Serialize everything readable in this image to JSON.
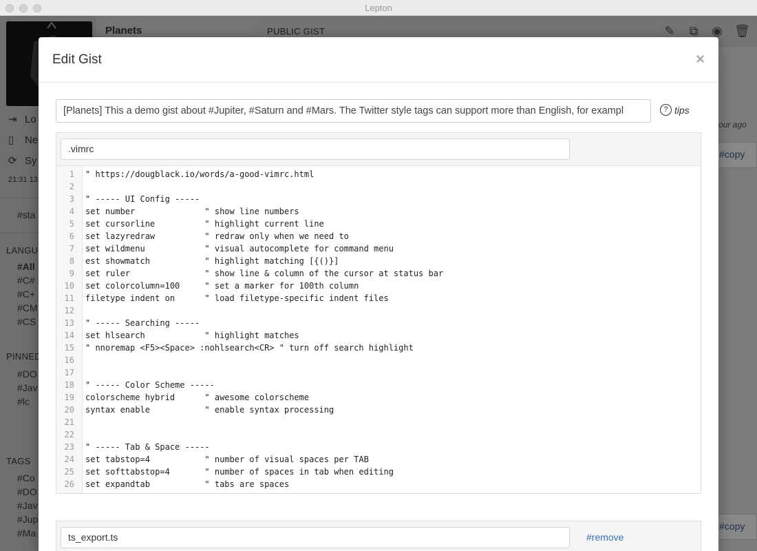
{
  "window": {
    "title": "Lepton"
  },
  "background": {
    "gist_title": "Planets",
    "gist_visibility": "PUBLIC GIST",
    "sidebar_actions": [
      "Lo",
      "Ne",
      "Sy"
    ],
    "sync_time": "21:31 13,",
    "starred_tag": "#sta",
    "languages_heading": "LANGU",
    "languages": [
      "#All",
      "#C#",
      "#C+",
      "#CM",
      "#CS"
    ],
    "pinned_heading": "PINNED",
    "pinned": [
      "#DO",
      "#Jav",
      "#lc"
    ],
    "tags_heading": "TAGS",
    "tags": [
      "#Co",
      "#DO",
      "#Jav",
      "#Jup",
      "#Ma"
    ],
    "time_ago": "our ago",
    "copy_labels": [
      "#copy",
      "#copy"
    ]
  },
  "modal": {
    "title": "Edit Gist",
    "close": "×",
    "description": "[Planets] This a demo gist about #Jupiter, #Saturn and #Mars. The Twitter style tags can support more than English, for exampl",
    "tips_icon": "?",
    "tips_label": "tips",
    "files": [
      {
        "filename": ".vimrc",
        "lines": [
          "\" https://dougblack.io/words/a-good-vimrc.html",
          "",
          "\" ----- UI Config -----",
          "set number              \" show line numbers",
          "set cursorline          \" highlight current line",
          "set lazyredraw          \" redraw only when we need to",
          "set wildmenu            \" visual autocomplete for command menu",
          "est showmatch           \" highlight matching [{()}]",
          "set ruler               \" show line & column of the cursor at status bar",
          "set colorcolumn=100     \" set a marker for 100th column",
          "filetype indent on      \" load filetype-specific indent files",
          "",
          "\" ----- Searching -----",
          "set hlsearch            \" highlight matches",
          "\" nnoremap <F5><Space> :nohlsearch<CR> \" turn off search highlight",
          "",
          "",
          "\" ----- Color Scheme -----",
          "colorscheme hybrid      \" awesome colorscheme",
          "syntax enable           \" enable syntax processing",
          "",
          "",
          "\" ----- Tab & Space -----",
          "set tabstop=4           \" number of visual spaces per TAB",
          "set softtabstop=4       \" number of spaces in tab when editing",
          "set expandtab           \" tabs are spaces"
        ]
      },
      {
        "filename": "ts_export.ts",
        "remove_label": "#remove"
      }
    ]
  }
}
